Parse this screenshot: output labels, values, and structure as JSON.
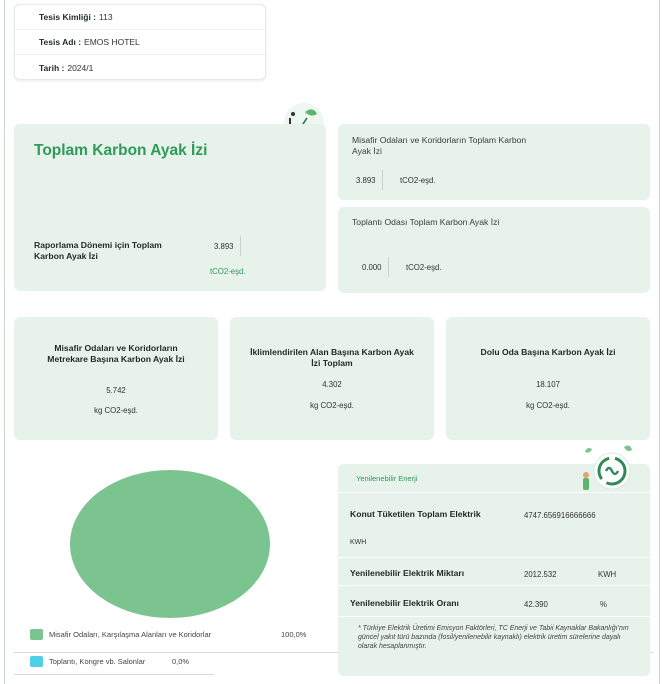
{
  "facility": {
    "id_label": "Tesis Kimliği :",
    "id_value": "113",
    "name_label": "Tesis Adı :",
    "name_value": "EMOS HOTEL",
    "date_label": "Tarih :",
    "date_value": "2024/1"
  },
  "total_card": {
    "title": "Toplam Karbon Ayak İzi",
    "period_label": "Raporlama Dönemi için Toplam Karbon Ayak İzi",
    "value": "3.893",
    "unit": "tCO2-eşd."
  },
  "guest_rooms_card": {
    "label": "Misafir Odaları ve Koridorların Toplam Karbon Ayak İzi",
    "value": "3.893",
    "unit": "tCO2-eşd."
  },
  "meeting_room_card": {
    "label": "Toplantı Odası Toplam Karbon Ayak İzi",
    "value": "0.000",
    "unit": "tCO2-eşd."
  },
  "per_area_cards": [
    {
      "label": "Misafir Odaları ve Koridorların Metrekare Başına Karbon Ayak İzi",
      "value": "5.742",
      "unit": "kg CO2-eşd."
    },
    {
      "label": "İklimlendirilen Alan Başına Karbon Ayak İzi Toplam",
      "value": "4.302",
      "unit": "kg CO2-eşd."
    },
    {
      "label": "Dolu Oda Başına Karbon Ayak İzi",
      "value": "18.107",
      "unit": "kg CO2-eşd."
    }
  ],
  "renewable": {
    "title": "Yenilenebilir Enerji",
    "total_label": "Konut Tüketilen Toplam Elektrik",
    "total_value": "4747.656916666666",
    "total_unit": "KWH",
    "amount_label": "Yenilenebilir Elektrik Miktarı",
    "amount_value": "2012.532",
    "amount_unit": "KWH",
    "rate_label": "Yenilenebilir Elektrik Oranı",
    "rate_value": "42.390",
    "rate_unit": "%",
    "footnote": "* Türkiye Elektrik Üretimi Emisyon Faktörleri, TC Enerji ve Tabii Kaynaklar Bakanlığı'nın güncel yakıt türü bazında (fosil/yenilenebilir kaynaklı) elektrik üretim sürelerine dayalı olarak hesaplanmıştır."
  },
  "chart_data": {
    "type": "pie",
    "categories": [
      "Misafir Odaları, Karşılaşma Alanları ve Koridorlar",
      "Toplantı, Kongre vb. Salonlar"
    ],
    "values": [
      100.0,
      0.0
    ],
    "value_labels": [
      "100,0%",
      "0,0%"
    ],
    "colors": [
      "#7cc48f",
      "#4fd0e6"
    ]
  },
  "icons": {
    "top_icon": "eco-bicycle-icon",
    "renewable_icon": "recycle-energy-icon"
  }
}
